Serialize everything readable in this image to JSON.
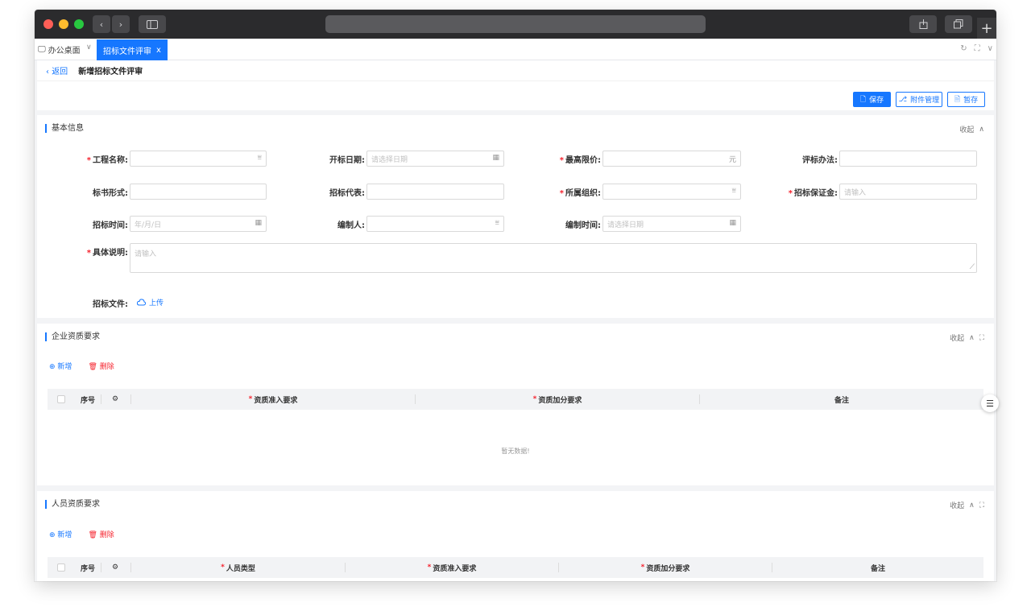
{
  "tabs": {
    "home_label": "办公桌面",
    "active_label": "招标文件评审",
    "active_close": "x"
  },
  "header": {
    "back_label": "返回",
    "title": "新增招标文件评审"
  },
  "toolbar": {
    "save_label": "保存",
    "attachment_label": "附件管理",
    "draft_label": "暂存"
  },
  "basic_info": {
    "title": "基本信息",
    "collapse_label": "收起",
    "fields": {
      "project_name": {
        "label": "工程名称:",
        "value": "",
        "placeholder": ""
      },
      "open_date": {
        "label": "开标日期:",
        "placeholder": "请选择日期"
      },
      "max_price": {
        "label": "最高限价:",
        "unit": "元"
      },
      "eval_method": {
        "label": "评标办法:"
      },
      "bid_form": {
        "label": "标书形式:"
      },
      "bid_agent": {
        "label": "招标代表:"
      },
      "org": {
        "label": "所属组织:"
      },
      "deposit": {
        "label": "招标保证金:",
        "placeholder": "请输入"
      },
      "bid_time": {
        "label": "招标时间:",
        "placeholder": "年/月/日"
      },
      "editor": {
        "label": "编制人:"
      },
      "edit_time": {
        "label": "编制时间:",
        "placeholder": "请选择日期"
      },
      "description": {
        "label": "具体说明:",
        "placeholder": "请输入"
      },
      "bid_file": {
        "label": "招标文件:",
        "upload_label": "上传"
      }
    }
  },
  "enterprise": {
    "title": "企业资质要求",
    "collapse_label": "收起",
    "add_label": "新增",
    "delete_label": "删除",
    "columns": [
      "序号",
      "资质准入要求",
      "资质加分要求",
      "备注"
    ],
    "empty_text": "暂无数据!"
  },
  "personnel": {
    "title": "人员资质要求",
    "collapse_label": "收起",
    "add_label": "新增",
    "delete_label": "删除",
    "columns": [
      "序号",
      "人员类型",
      "资质准入要求",
      "资质加分要求",
      "备注"
    ]
  },
  "colors": {
    "primary": "#1677ff",
    "danger": "#f5222d",
    "titlebar": "#2b2b2d"
  }
}
